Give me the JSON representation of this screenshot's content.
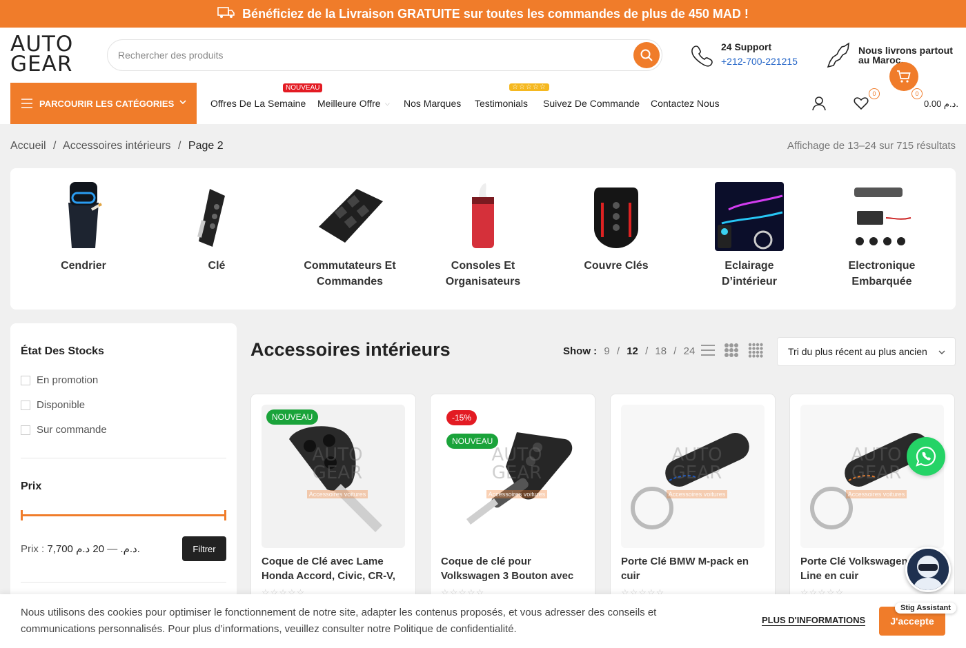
{
  "topbar": {
    "text": "Bénéficiez de la Livraison GRATUITE sur toutes les commandes de plus de 450 MAD !"
  },
  "logo": {
    "line1": "AUTO",
    "line2": "GEAR"
  },
  "search": {
    "placeholder": "Rechercher des produits"
  },
  "support": {
    "title": "24 Support",
    "phone": "+212-700-221215"
  },
  "delivery": {
    "text": "Nous livrons partout au Maroc."
  },
  "categories_button": {
    "label": "PARCOURIR LES CATÉGORIES"
  },
  "nav": {
    "items": [
      {
        "label": "Offres De La Semaine",
        "badge": "NOUVEAU"
      },
      {
        "label": "Meilleure Offre"
      },
      {
        "label": "Nos Marques"
      },
      {
        "label": "Testimonials",
        "badge": "☆☆☆☆☆"
      },
      {
        "label": "Suivez De Commande"
      },
      {
        "label": "Contactez Nous"
      }
    ]
  },
  "header_icons": {
    "wishlist_count": "0",
    "cart_count": "0",
    "cart_total": "0.00 د.م."
  },
  "breadcrumb": {
    "home": "Accueil",
    "sep": "/",
    "category": "Accessoires intérieurs",
    "current": "Page 2"
  },
  "results": "Affichage de 13–24 sur 715 résultats",
  "subcategories": [
    {
      "line1": "Cendrier",
      "line2": ""
    },
    {
      "line1": "Clé",
      "line2": ""
    },
    {
      "line1": "Commutateurs Et",
      "line2": "Commandes"
    },
    {
      "line1": "Consoles Et",
      "line2": "Organisateurs"
    },
    {
      "line1": "Couvre Clés",
      "line2": ""
    },
    {
      "line1": "Eclairage",
      "line2": "D’intérieur"
    },
    {
      "line1": "Electronique",
      "line2": "Embarquée"
    }
  ],
  "sidebar": {
    "stock_title": "État Des Stocks",
    "stock_options": [
      "En promotion",
      "Disponible",
      "Sur commande"
    ],
    "price_title": "Prix",
    "price_label": "Prix :",
    "price_min": "20 د.م.",
    "price_dash": "—",
    "price_max": "7,700 د.م.",
    "filter_button": "Filtrer"
  },
  "page_title": "Accessoires intérieurs",
  "show": {
    "label": "Show :",
    "options": [
      "9",
      "12",
      "18",
      "24"
    ],
    "selected": "12"
  },
  "sort": {
    "selected": "Tri du plus récent au plus ancien"
  },
  "products": [
    {
      "line1": "Coque de Clé avec Lame",
      "line2": "Honda Accord, Civic, CR-V,",
      "badges": [
        "NOUVEAU"
      ]
    },
    {
      "line1": "Coque de clé pour",
      "line2": "Volkswagen 3 Bouton avec",
      "badges": [
        "-15%",
        "NOUVEAU"
      ]
    },
    {
      "line1": "Porte Clé BMW M-pack en",
      "line2": "cuir",
      "badges": []
    },
    {
      "line1": "Porte Clé Volkswagen R-",
      "line2": "Line en cuir",
      "badges": []
    }
  ],
  "watermark": {
    "line1": "AUTO",
    "line2": "GEAR",
    "tag": "Accessoires voitures"
  },
  "cookie": {
    "text": "Nous utilisons des cookies pour optimiser le fonctionnement de notre site, adapter les contenus proposés, et vous adresser des conseils et communications personnalisés. Pour plus d’informations, veuillez consulter notre Politique de confidentialité.",
    "more": "PLUS D'INFORMATIONS",
    "accept": "J'accepte"
  },
  "assistant": {
    "label": "Stig Assistant"
  },
  "colors": {
    "accent": "#f07c2a",
    "new_badge": "#1aa33a",
    "sale_badge": "#e31b23",
    "whatsapp": "#25d366"
  }
}
